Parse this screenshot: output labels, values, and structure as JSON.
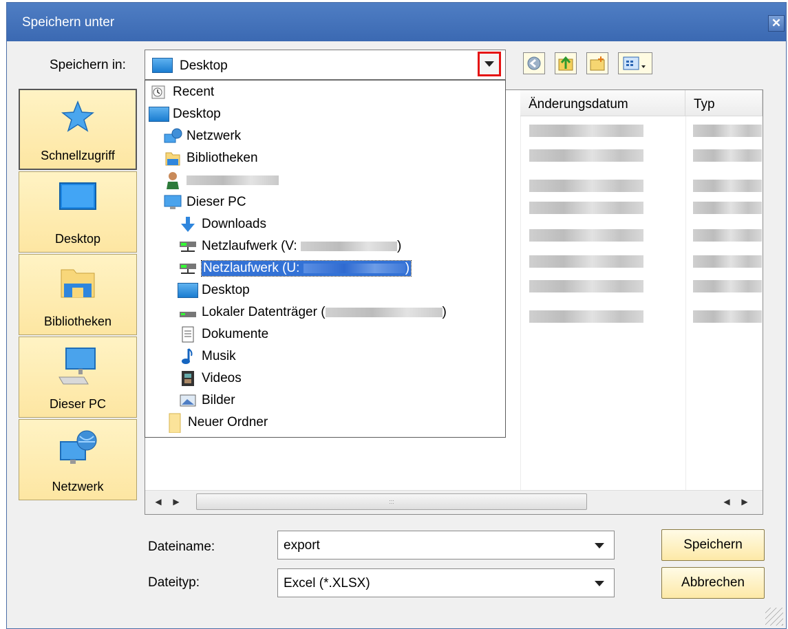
{
  "window": {
    "title": "Speichern unter"
  },
  "save_in": {
    "label": "Speichern in:",
    "value": "Desktop"
  },
  "places": [
    {
      "label": "Schnellzugriff",
      "icon": "star-icon"
    },
    {
      "label": "Desktop",
      "icon": "desktop-icon"
    },
    {
      "label": "Bibliotheken",
      "icon": "library-icon"
    },
    {
      "label": "Dieser PC",
      "icon": "computer-icon"
    },
    {
      "label": "Netzwerk",
      "icon": "network-icon"
    }
  ],
  "columns": {
    "date": "Änderungsdatum",
    "type": "Typ"
  },
  "dropdown": {
    "items": [
      {
        "label": "Recent"
      },
      {
        "label": "Desktop"
      },
      {
        "label": "Netzwerk"
      },
      {
        "label": "Bibliotheken"
      },
      {
        "label": ""
      },
      {
        "label": "Dieser PC"
      },
      {
        "label": "Downloads"
      },
      {
        "label": "Netzlaufwerk (V:",
        "suffix": ")"
      },
      {
        "label": "Netzlaufwerk (U:",
        "suffix": ")"
      },
      {
        "label": "Desktop"
      },
      {
        "label": "Lokaler Datenträger (",
        "suffix": ")"
      },
      {
        "label": "Dokumente"
      },
      {
        "label": "Musik"
      },
      {
        "label": "Videos"
      },
      {
        "label": "Bilder"
      },
      {
        "label": "Neuer Ordner"
      }
    ]
  },
  "filename": {
    "label": "Dateiname:",
    "value": "export"
  },
  "filetype": {
    "label": "Dateityp:",
    "value": "Excel (*.XLSX)"
  },
  "buttons": {
    "save": "Speichern",
    "cancel": "Abbrechen"
  },
  "colors": {
    "title_bar": "#3b69b2",
    "highlight": "#3372d6",
    "focus_box": "#e51212",
    "place_bg": "#fde6a2"
  }
}
